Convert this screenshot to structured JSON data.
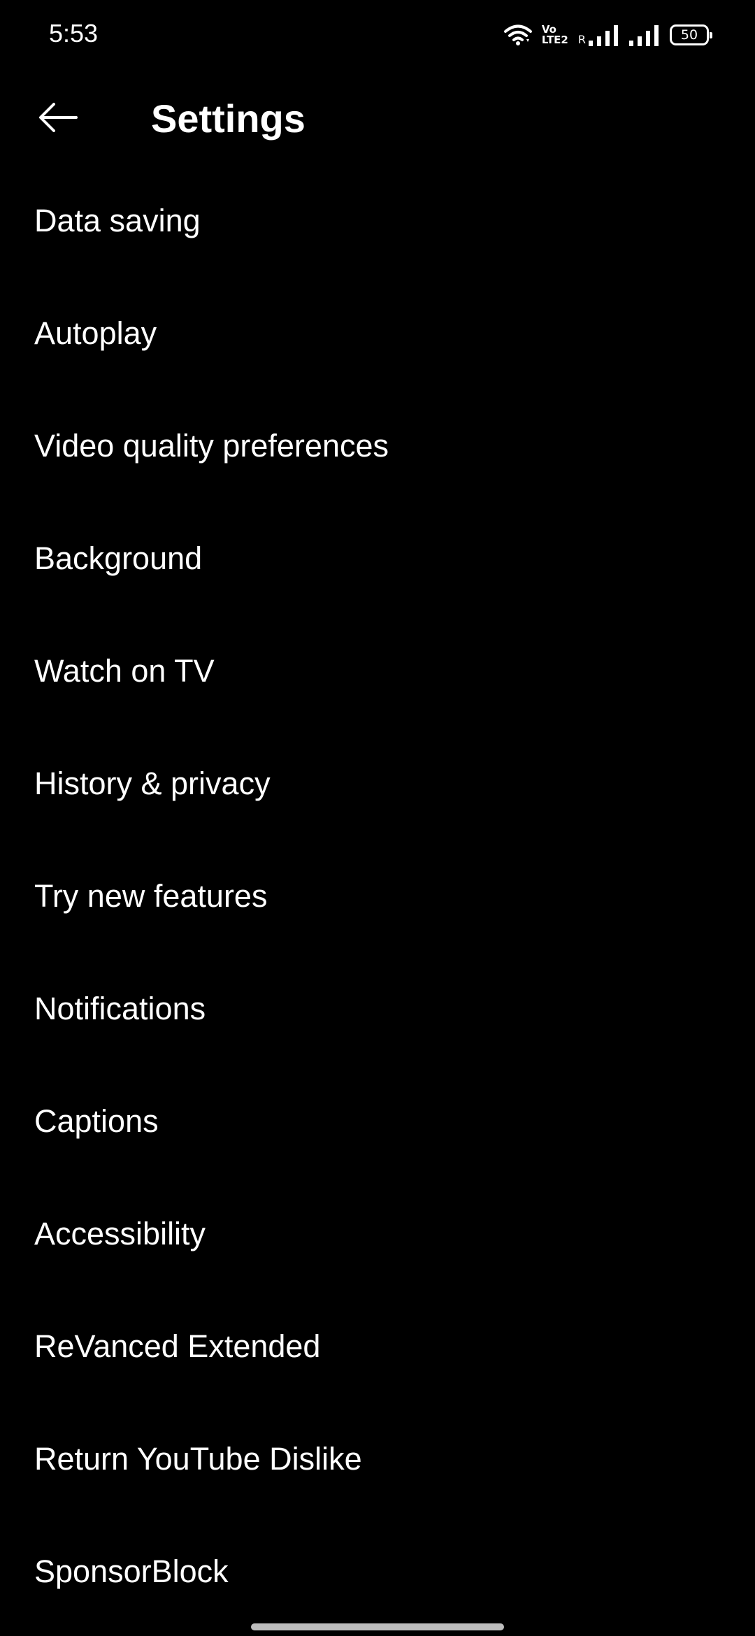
{
  "status_bar": {
    "time": "5:53",
    "volte_top": "Vo",
    "volte_bottom": "LTE2",
    "roaming_indicator": "R",
    "battery_level": "50",
    "icons": [
      "wifi-icon",
      "volte-icon",
      "signal-icon",
      "signal-icon",
      "battery-icon"
    ]
  },
  "header": {
    "title": "Settings",
    "back_icon": "arrow-left-icon"
  },
  "settings": {
    "items": [
      {
        "label": "Data saving"
      },
      {
        "label": "Autoplay"
      },
      {
        "label": "Video quality preferences"
      },
      {
        "label": "Background"
      },
      {
        "label": "Watch on TV"
      },
      {
        "label": "History & privacy"
      },
      {
        "label": "Try new features"
      },
      {
        "label": "Notifications"
      },
      {
        "label": "Captions"
      },
      {
        "label": "Accessibility"
      },
      {
        "label": "ReVanced Extended"
      },
      {
        "label": "Return YouTube Dislike"
      },
      {
        "label": "SponsorBlock"
      }
    ]
  },
  "colors": {
    "background": "#000000",
    "text": "#ffffff",
    "gesture_bar": "#bdbdbd"
  }
}
